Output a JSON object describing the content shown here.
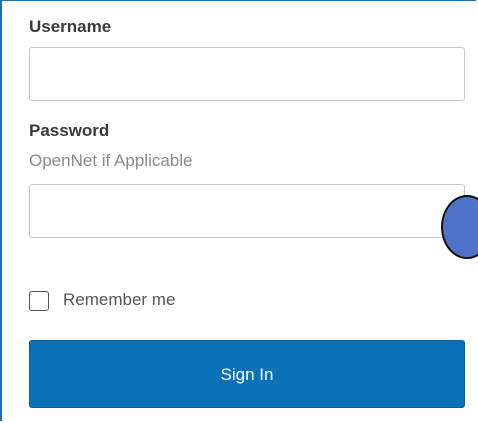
{
  "form": {
    "username_label": "Username",
    "username_value": "",
    "password_label": "Password",
    "password_hint": "OpenNet if Applicable",
    "password_value": "",
    "remember_label": "Remember me",
    "remember_checked": false,
    "signin_label": "Sign In"
  },
  "colors": {
    "accent": "#0c72b8",
    "panel_border": "#1f6db3",
    "cursor_marker": "#4f73c9"
  }
}
